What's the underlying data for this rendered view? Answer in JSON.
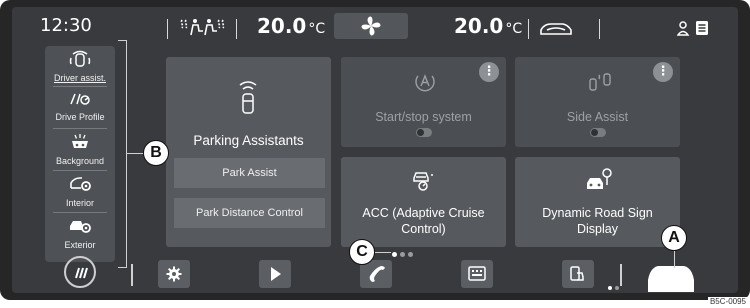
{
  "status_bar": {
    "clock": "12:30",
    "temp_left_value": "20.0",
    "temp_left_unit": "°C",
    "temp_right_value": "20.0",
    "temp_right_unit": "°C"
  },
  "side_panel": {
    "items": [
      {
        "label": "Driver assist.",
        "icon": "driver-assist-icon",
        "active": true
      },
      {
        "label": "Drive Profile",
        "icon": "drive-profile-icon",
        "active": false
      },
      {
        "label": "Background",
        "icon": "background-icon",
        "active": false
      },
      {
        "label": "Interior",
        "icon": "interior-icon",
        "active": false
      },
      {
        "label": "Exterior",
        "icon": "exterior-icon",
        "active": false
      }
    ]
  },
  "tiles": {
    "parking": {
      "title": "Parking Assistants",
      "buttons": [
        "Park Assist",
        "Park Distance Control"
      ]
    },
    "start_stop": {
      "title": "Start/stop system",
      "enabled": false
    },
    "side_assist": {
      "title": "Side Assist",
      "enabled": false
    },
    "acc": {
      "title_line1": "ACC (Adaptive Cruise",
      "title_line2": "Control)"
    },
    "road_sign": {
      "title_line1": "Dynamic Road Sign",
      "title_line2": "Display"
    }
  },
  "callouts": {
    "a": "A",
    "b": "B",
    "c": "C"
  },
  "page_indicator": {
    "pages": 3,
    "current": 1
  },
  "dock": {
    "items": [
      "menu-icon",
      "settings-icon",
      "play-icon",
      "phone-icon",
      "keyboard-icon",
      "app-connect-icon",
      "car-icon"
    ]
  },
  "colors": {
    "background": "#383a3d",
    "tile": "#56595d",
    "panel": "#4e5155",
    "accent_white": "#ffffff"
  },
  "figure_code": "B5C-0095"
}
